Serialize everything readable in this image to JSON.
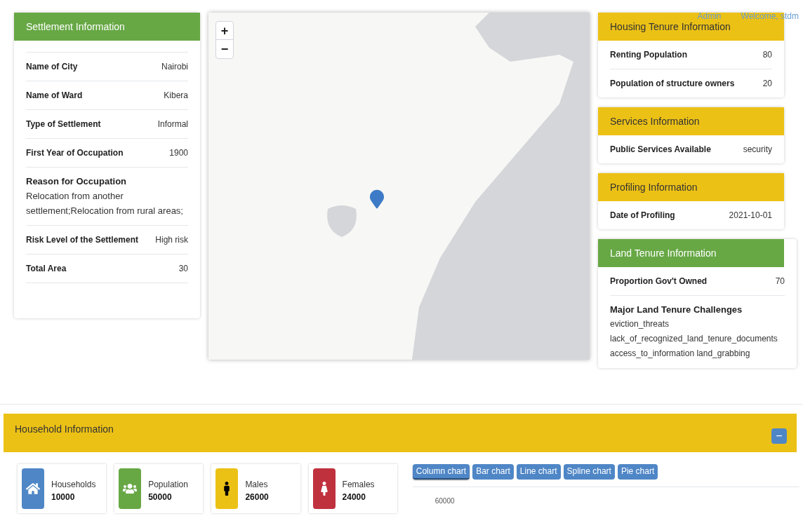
{
  "header": {
    "links": [
      "Admin",
      "Welcome, stdm"
    ]
  },
  "settlement": {
    "title": "Settlement Information",
    "rows": [
      {
        "kind": "inline",
        "label": "Name of City",
        "value": "Nairobi"
      },
      {
        "kind": "inline",
        "label": "Name of Ward",
        "value": "Kibera"
      },
      {
        "kind": "inline",
        "label": "Type of Settlement",
        "value": "Informal"
      },
      {
        "kind": "inline",
        "label": "First Year of Occupation",
        "value": "1900"
      },
      {
        "kind": "stacked",
        "label": "Reason for Occupation",
        "value": "Relocation from another settlement;Relocation from rural areas;"
      },
      {
        "kind": "inline",
        "label": "Risk Level of the Settlement",
        "value": "High risk"
      },
      {
        "kind": "inline",
        "label": "Total Area",
        "value": "30"
      }
    ]
  },
  "map": {
    "zoom_in": "+",
    "zoom_out": "−"
  },
  "panels": [
    {
      "title": "Housing Tenure Information",
      "color": "#ecc116",
      "rows": [
        {
          "kind": "inline",
          "label": "Renting Population",
          "value": "80"
        },
        {
          "kind": "inline",
          "label": "Population of structure owners",
          "value": "20"
        }
      ]
    },
    {
      "title": "Services Information",
      "color": "#ecc116",
      "rows": [
        {
          "kind": "inline",
          "label": "Public Services Available",
          "value": "security"
        }
      ]
    },
    {
      "title": "Profiling Information",
      "color": "#ecc116",
      "rows": [
        {
          "kind": "inline",
          "label": "Date of Profiling",
          "value": "2021-10-01"
        }
      ]
    },
    {
      "title": "Land Tenure Information",
      "color": "#67a845",
      "rows": [
        {
          "kind": "inline",
          "label": "Proportion Gov't Owned",
          "value": "70"
        },
        {
          "kind": "list",
          "label": "Major Land Tenure Challenges",
          "values": [
            "eviction_threats",
            "lack_of_recognized_land_tenure_documents",
            "access_to_information land_grabbing"
          ]
        }
      ]
    }
  ],
  "household": {
    "title": "Household Information",
    "collapse": "−",
    "stats": [
      {
        "kind": "house",
        "label": "Households",
        "value": "10000",
        "color": "#4f86c6"
      },
      {
        "kind": "users",
        "label": "Population",
        "value": "50000",
        "color": "#67a845"
      },
      {
        "kind": "male",
        "label": "Males",
        "value": "26000",
        "color": "#ecc116"
      },
      {
        "kind": "female",
        "label": "Females",
        "value": "24000",
        "color": "#c0313e"
      }
    ],
    "chart_buttons": [
      {
        "label": "Column chart",
        "selected": true
      },
      {
        "label": "Bar chart",
        "selected": false
      },
      {
        "label": "Line chart",
        "selected": false
      },
      {
        "label": "Spline chart",
        "selected": false
      },
      {
        "label": "Pie chart",
        "selected": false
      }
    ],
    "y_tick": "60000"
  }
}
